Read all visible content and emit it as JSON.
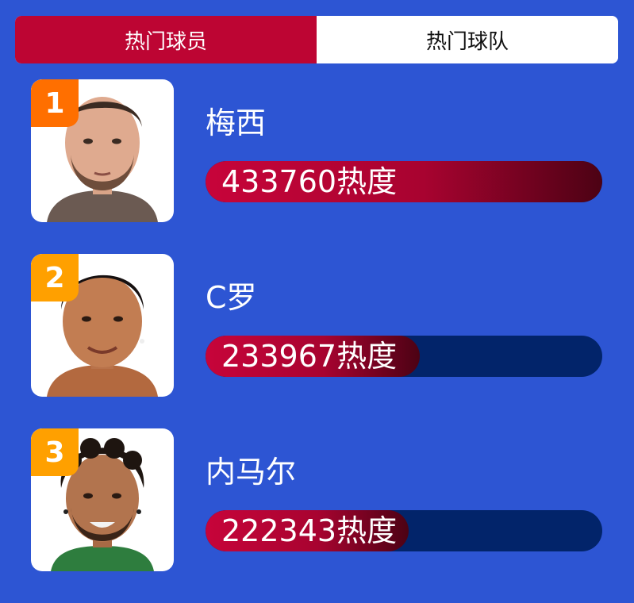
{
  "tabs": [
    {
      "label": "热门球员",
      "active": true
    },
    {
      "label": "热门球队",
      "active": false
    }
  ],
  "players": [
    {
      "rank": "1",
      "name": "梅西",
      "heat": "433760",
      "heat_unit": "热度",
      "heat_fraction": 1.0,
      "rank_color": "#ff6f00"
    },
    {
      "rank": "2",
      "name": "C罗",
      "heat": "233967",
      "heat_unit": "热度",
      "heat_fraction": 0.539,
      "rank_color": "#ffa000"
    },
    {
      "rank": "3",
      "name": "内马尔",
      "heat": "222343",
      "heat_unit": "热度",
      "heat_fraction": 0.512,
      "rank_color": "#ffa000"
    }
  ],
  "colors": {
    "background": "#2d55d3",
    "tab_active": "#bd0533",
    "bar_track": "#02246a",
    "bar_fill_start": "#c7043a",
    "bar_fill_end": "#4c0214"
  }
}
